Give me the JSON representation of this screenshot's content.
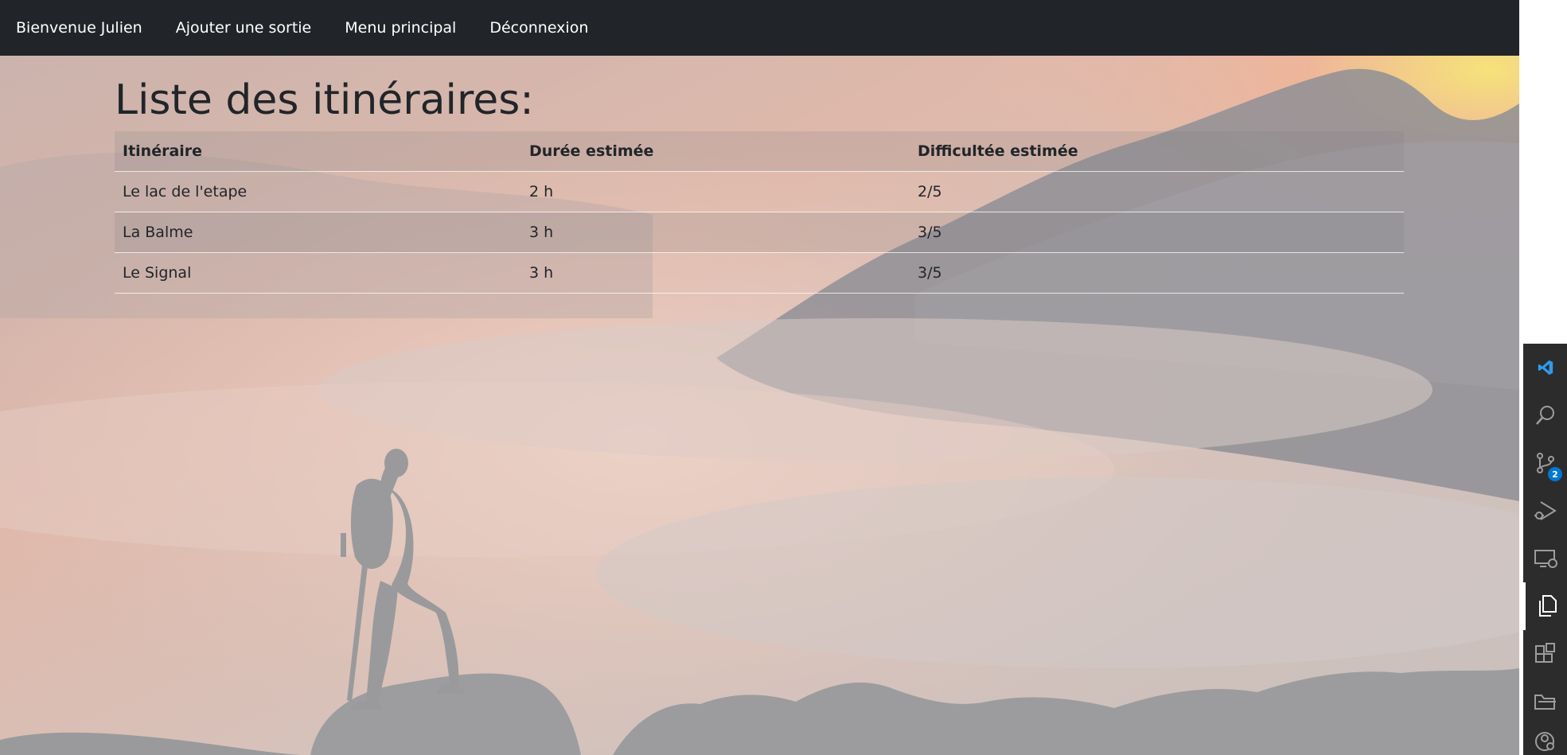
{
  "navbar": {
    "items": [
      {
        "label": "Bienvenue Julien"
      },
      {
        "label": "Ajouter une sortie"
      },
      {
        "label": "Menu principal"
      },
      {
        "label": "Déconnexion"
      }
    ]
  },
  "main": {
    "title": "Liste des itinéraires:",
    "table": {
      "columns": [
        "Itinéraire",
        "Durée estimée",
        "Difficultée estimée"
      ],
      "rows": [
        [
          "Le lac de l'etape",
          "2 h",
          "2/5"
        ],
        [
          "La Balme",
          "3 h",
          "3/5"
        ],
        [
          "Le Signal",
          "3 h",
          "3/5"
        ]
      ]
    }
  },
  "activity_bar": {
    "items": [
      {
        "icon": "vscode-logo-icon"
      },
      {
        "icon": "search-icon"
      },
      {
        "icon": "source-control-icon",
        "badge": "2"
      },
      {
        "icon": "run-debug-icon"
      },
      {
        "icon": "remote-explorer-icon"
      },
      {
        "icon": "explorer-files-icon",
        "active": true
      },
      {
        "icon": "extensions-icon"
      },
      {
        "icon": "folder-icon"
      },
      {
        "icon": "accounts-icon"
      }
    ]
  },
  "colors": {
    "navbar_bg": "#212529",
    "activity_bar_bg": "#2c2c2c",
    "badge_bg": "#0078d4",
    "vscode_blue": "#2f9bea"
  }
}
